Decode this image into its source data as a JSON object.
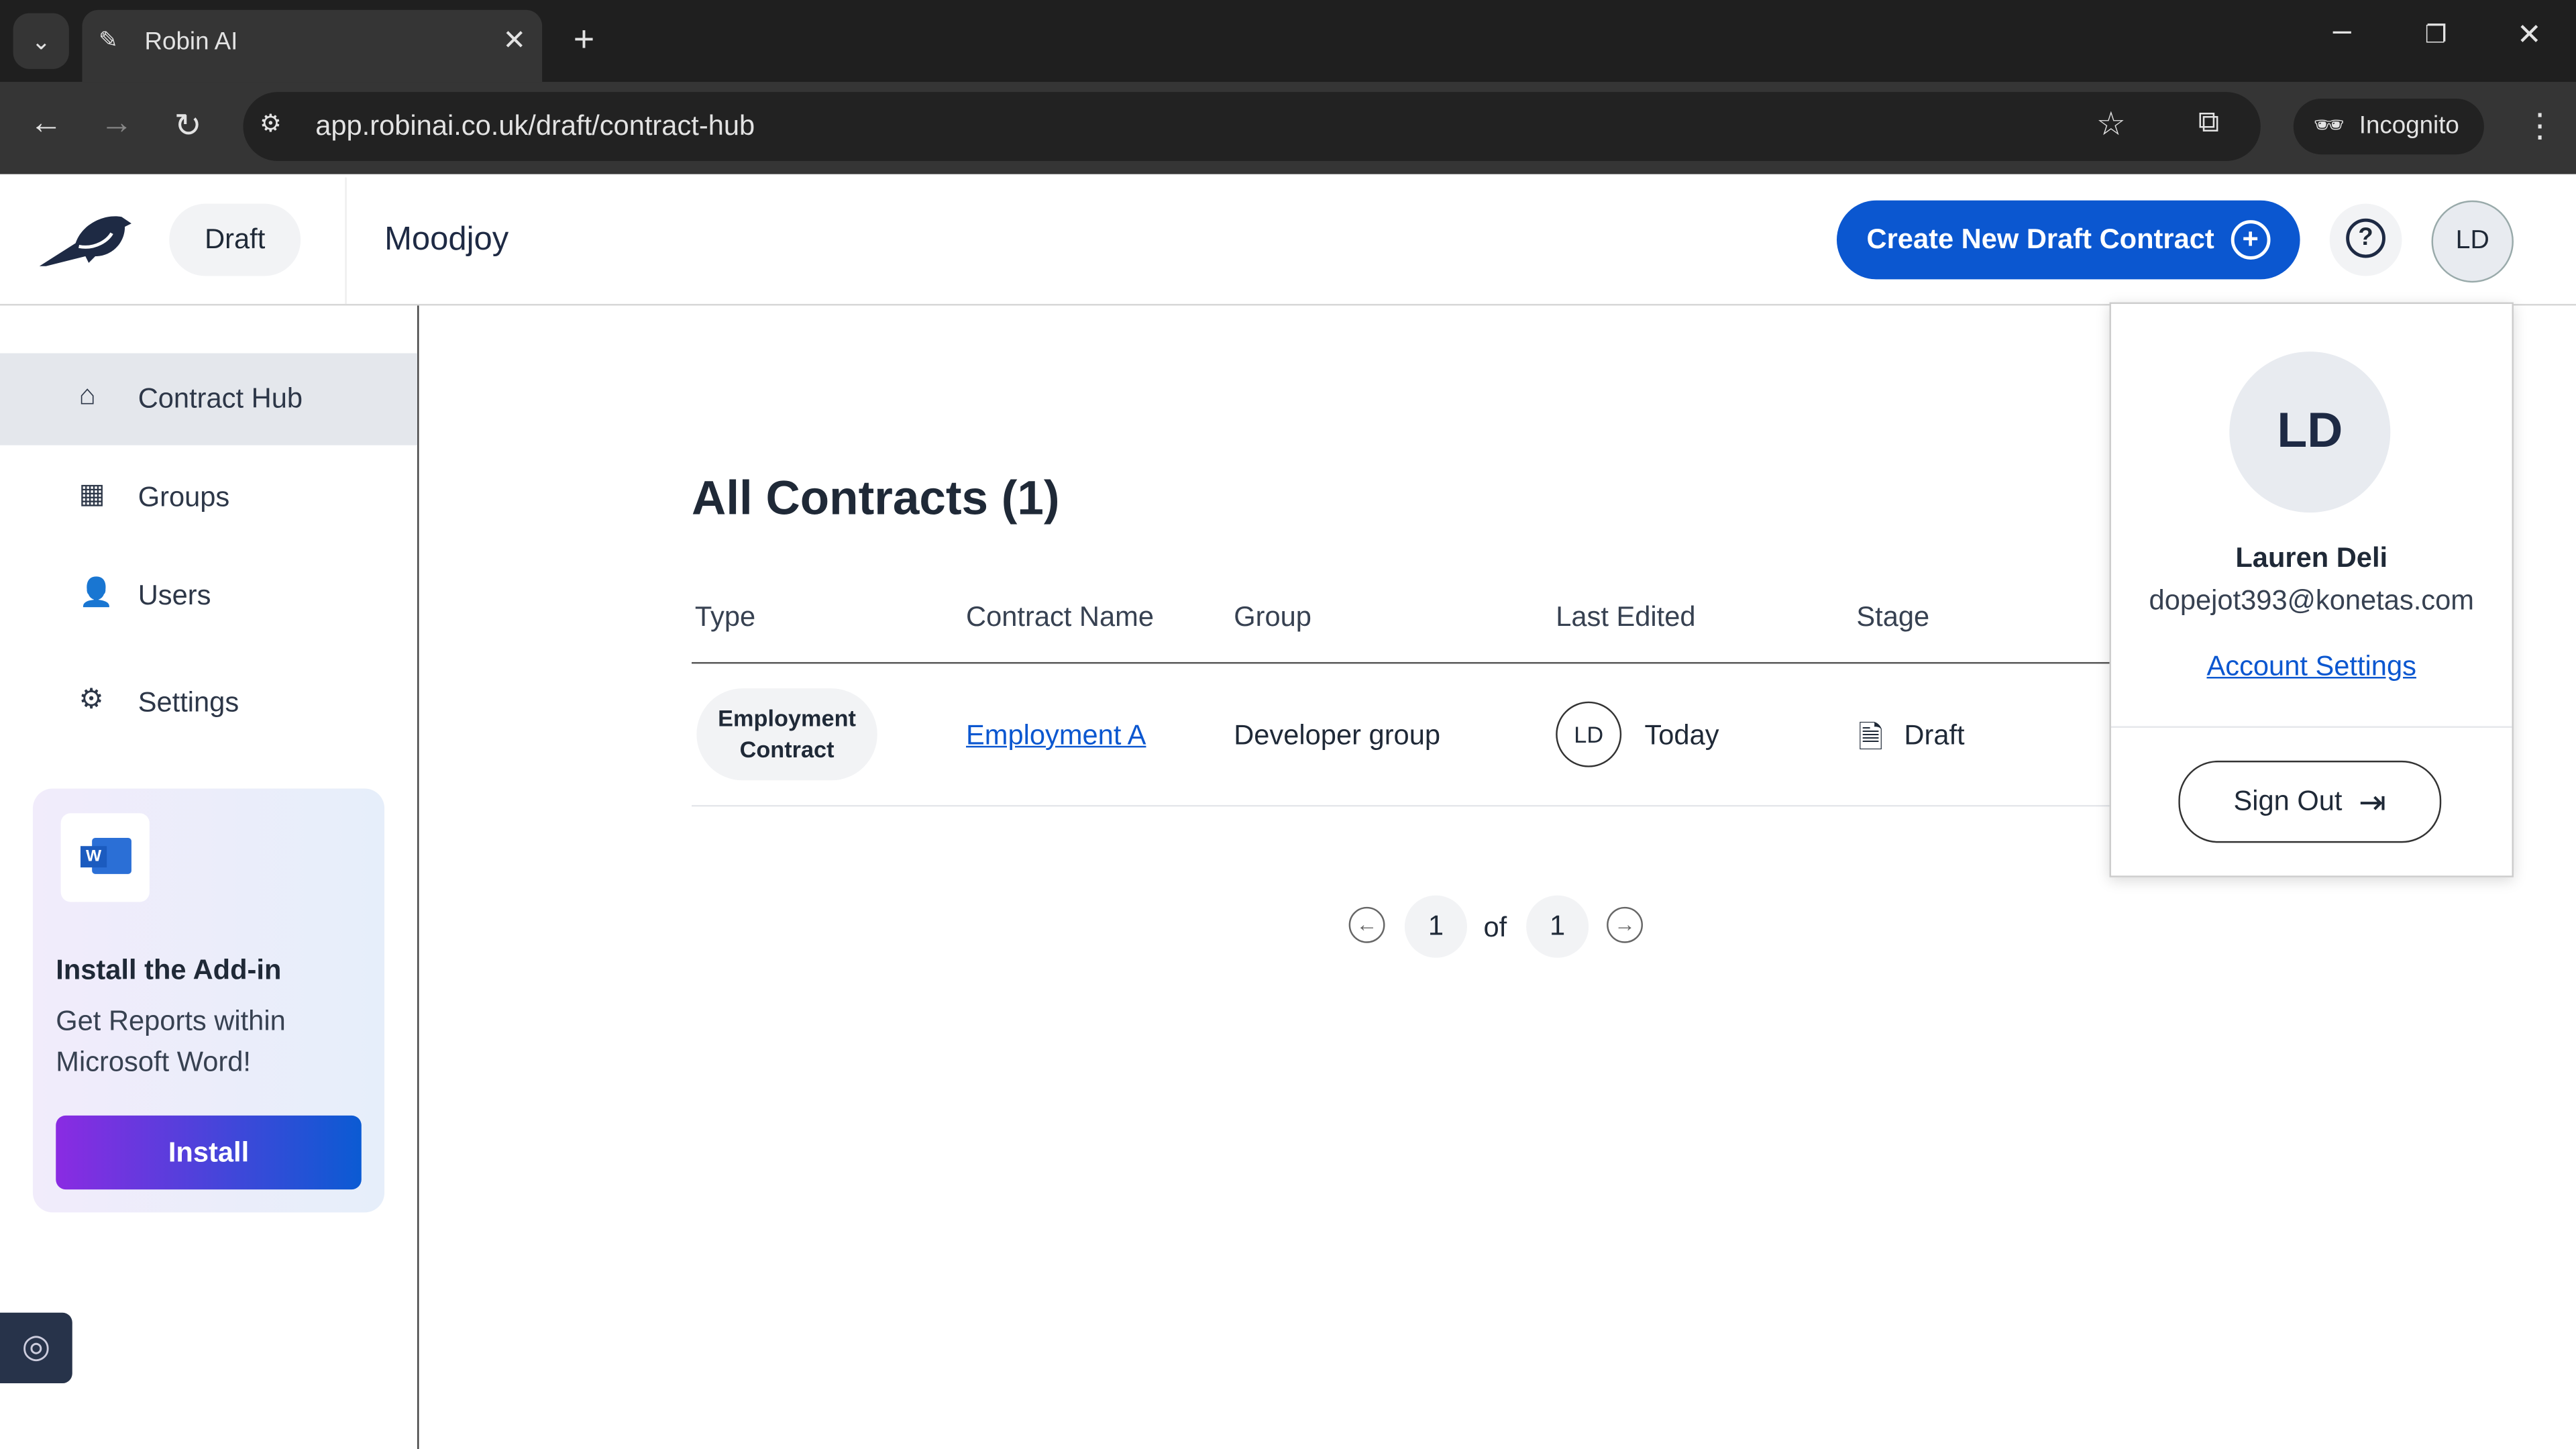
{
  "browser": {
    "tab_title": "Robin AI",
    "url": "app.robinai.co.uk/draft/contract-hub",
    "incognito_label": "Incognito"
  },
  "header": {
    "product": "Draft",
    "workspace": "Moodjoy",
    "create_button": "Create New Draft Contract",
    "avatar_initials": "LD"
  },
  "sidebar": {
    "items": [
      {
        "label": "Contract Hub",
        "icon": "home-icon",
        "active": true
      },
      {
        "label": "Groups",
        "icon": "grid-icon"
      },
      {
        "label": "Users",
        "icon": "user-icon"
      },
      {
        "label": "Settings",
        "icon": "gear-icon"
      }
    ],
    "addin": {
      "title": "Install the Add-in",
      "line1": "Get Reports within",
      "line2": "Microsoft Word!",
      "button": "Install"
    }
  },
  "main": {
    "title": "All Contracts (1)",
    "columns": [
      "Type",
      "Contract Name",
      "Group",
      "Last Edited",
      "Stage"
    ],
    "rows": [
      {
        "type_line1": "Employment",
        "type_line2": "Contract",
        "name": "Employment A",
        "group": "Developer group",
        "editor": "LD",
        "last_edited": "Today",
        "stage": "Draft"
      }
    ],
    "pagination": {
      "current": "1",
      "of": "of",
      "total": "1"
    }
  },
  "profile_menu": {
    "initials": "LD",
    "name": "Lauren Deli",
    "email": "dopejot393@konetas.com",
    "account_settings": "Account Settings",
    "sign_out": "Sign Out"
  },
  "colors": {
    "primary": "#0b57d0",
    "install_gradient_start": "#8a2be2",
    "install_gradient_end": "#0b5bd3",
    "brand_navy": "#1e2a44"
  }
}
